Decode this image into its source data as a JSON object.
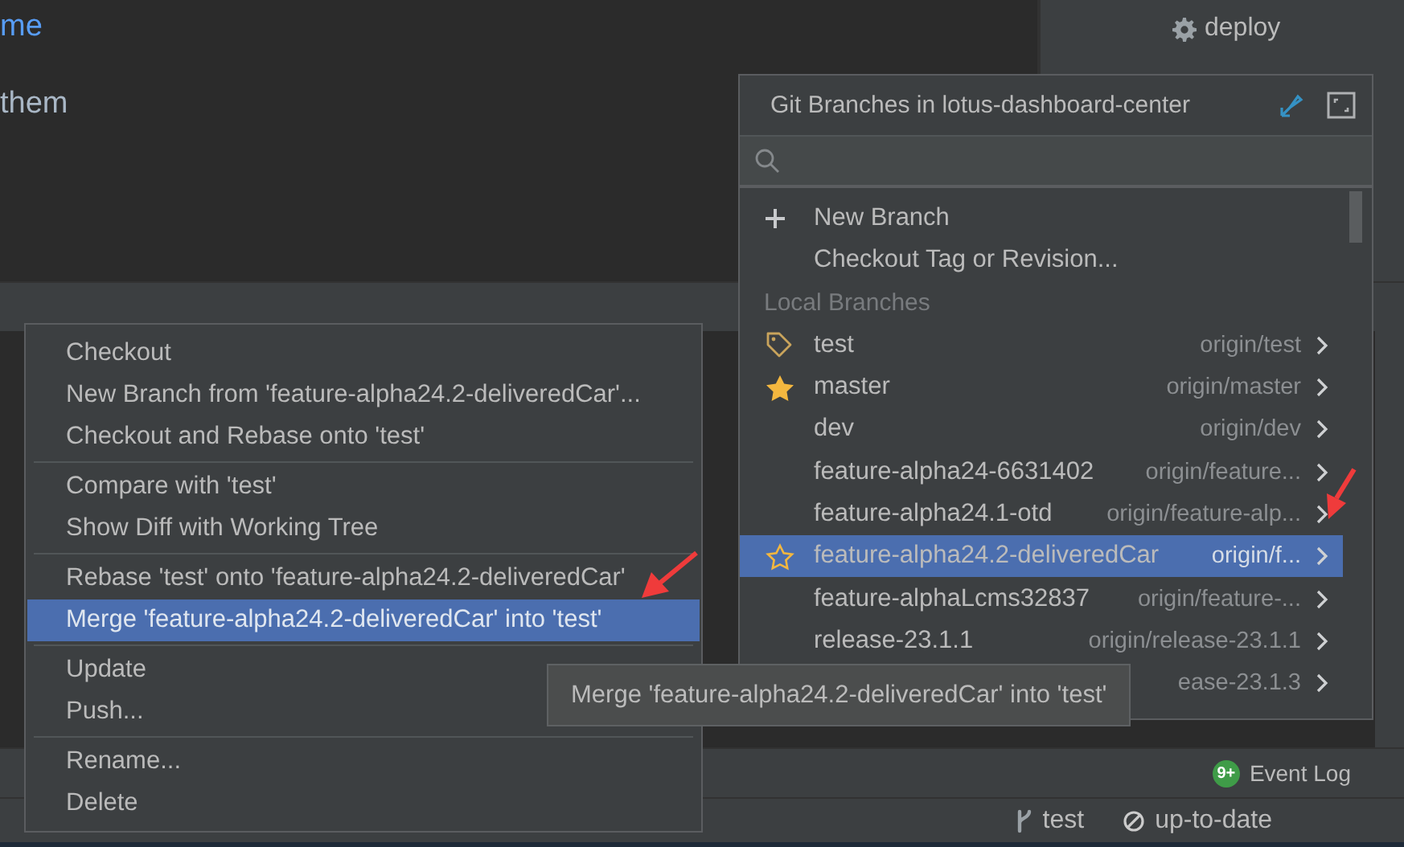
{
  "editor": {
    "lines": [
      {
        "text": "me",
        "kind": "link"
      },
      {
        "text": "them",
        "kind": "plain"
      }
    ]
  },
  "project_tree": {
    "items": [
      {
        "label": "deploy",
        "kind": "gear"
      }
    ]
  },
  "context_menu": {
    "groups": [
      [
        {
          "label": "Checkout",
          "selected": false
        },
        {
          "label": "New Branch from 'feature-alpha24.2-deliveredCar'...",
          "selected": false
        },
        {
          "label": "Checkout and Rebase onto 'test'",
          "selected": false
        }
      ],
      [
        {
          "label": "Compare with 'test'",
          "selected": false
        },
        {
          "label": "Show Diff with Working Tree",
          "selected": false
        }
      ],
      [
        {
          "label": "Rebase 'test' onto 'feature-alpha24.2-deliveredCar'",
          "selected": false
        },
        {
          "label": "Merge 'feature-alpha24.2-deliveredCar' into 'test'",
          "selected": true
        }
      ],
      [
        {
          "label": "Update",
          "selected": false
        },
        {
          "label": "Push...",
          "selected": false
        }
      ],
      [
        {
          "label": "Rename...",
          "selected": false
        },
        {
          "label": "Delete",
          "selected": false
        }
      ]
    ]
  },
  "git_branches_popup": {
    "title": "Git Branches in lotus-dashboard-center",
    "actions": [
      {
        "label": "New Branch",
        "kind": "add"
      },
      {
        "label": "Checkout Tag or Revision...",
        "kind": "plain"
      }
    ],
    "section_header": "Local Branches",
    "branches": [
      {
        "name": "test",
        "remote": "origin/test",
        "kind": "tag",
        "selected": false
      },
      {
        "name": "master",
        "remote": "origin/master",
        "kind": "favorite",
        "selected": false
      },
      {
        "name": "dev",
        "remote": "origin/dev",
        "kind": "plain",
        "selected": false
      },
      {
        "name": "feature-alpha24-6631402",
        "remote": "origin/feature...",
        "kind": "plain",
        "selected": false
      },
      {
        "name": "feature-alpha24.1-otd",
        "remote": "origin/feature-alp...",
        "kind": "plain",
        "selected": false
      },
      {
        "name": "feature-alpha24.2-deliveredCar",
        "remote": "origin/f...",
        "kind": "star-outline",
        "selected": true
      },
      {
        "name": "feature-alphaLcms32837",
        "remote": "origin/feature-...",
        "kind": "plain",
        "selected": false
      },
      {
        "name": "release-23.1.1",
        "remote": "origin/release-23.1.1",
        "kind": "plain",
        "selected": false
      },
      {
        "remote": "ease-23.1.3",
        "kind": "plain",
        "selected": false
      }
    ]
  },
  "tooltip": {
    "text": "Merge 'feature-alpha24.2-deliveredCar' into 'test'"
  },
  "tool_bar": {
    "event_log": {
      "badge": "9+",
      "label": "Event Log"
    }
  },
  "status_bar": {
    "branch": "test",
    "sync": "up-to-date"
  }
}
